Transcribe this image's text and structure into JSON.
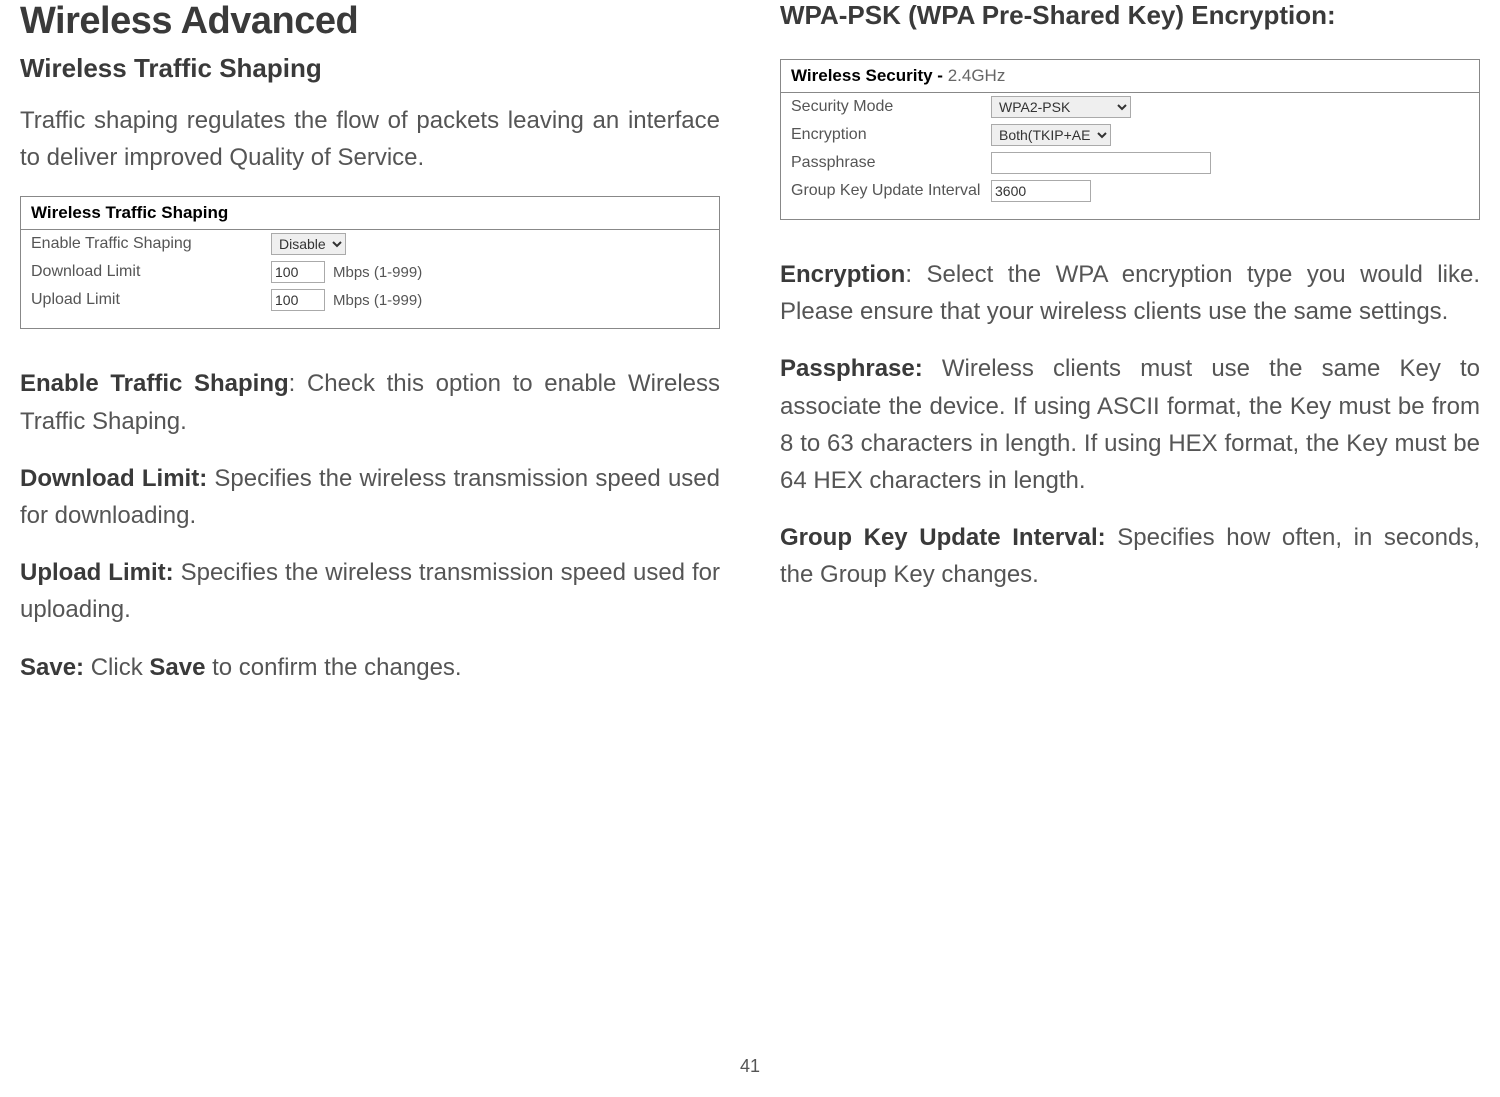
{
  "page_number": "41",
  "left": {
    "h1": "Wireless Advanced",
    "h2": "Wireless Traffic Shaping",
    "intro": "Traffic shaping regulates the flow of packets leaving an interface to deliver improved Quality of Service.",
    "panel": {
      "title": "Wireless Traffic Shaping",
      "rows": {
        "enable": {
          "label": "Enable Traffic Shaping",
          "value": "Disable"
        },
        "download": {
          "label": "Download Limit",
          "value": "100",
          "hint": "Mbps (1-999)"
        },
        "upload": {
          "label": "Upload Limit",
          "value": "100",
          "hint": "Mbps (1-999)"
        }
      }
    },
    "p1_b": "Enable Traffic Shaping",
    "p1": ": Check this option to enable Wireless Traffic Shaping.",
    "p2_b": "Download Limit:",
    "p2": " Specifies the wireless transmission speed used for downloading.",
    "p3_b": "Upload Limit:",
    "p3": " Specifies the wireless transmission speed used for uploading.",
    "p4_b1": "Save:",
    "p4_mid": " Click ",
    "p4_b2": "Save",
    "p4_end": " to confirm the changes."
  },
  "right": {
    "h3": "WPA-PSK (WPA Pre-Shared Key) Encryption:",
    "panel": {
      "title": "Wireless Security - ",
      "title_sub": "2.4GHz",
      "rows": {
        "mode": {
          "label": "Security Mode",
          "value": "WPA2-PSK"
        },
        "enc": {
          "label": "Encryption",
          "value": "Both(TKIP+AES)"
        },
        "pass": {
          "label": "Passphrase",
          "value": ""
        },
        "gku": {
          "label": "Group Key Update Interval",
          "value": "3600"
        }
      }
    },
    "p1_b": "Encryption",
    "p1": ": Select the WPA encryption type you would like. Please ensure that your wireless clients use the same settings.",
    "p2_b": "Passphrase:",
    "p2": " Wireless clients must use the same Key to associate the device. If using ASCII format, the Key must be from 8 to 63 characters in length. If using HEX format, the Key must be 64 HEX characters in length.",
    "p3_b": "Group Key Update Interval:",
    "p3": " Specifies how often, in seconds, the Group Key changes."
  }
}
